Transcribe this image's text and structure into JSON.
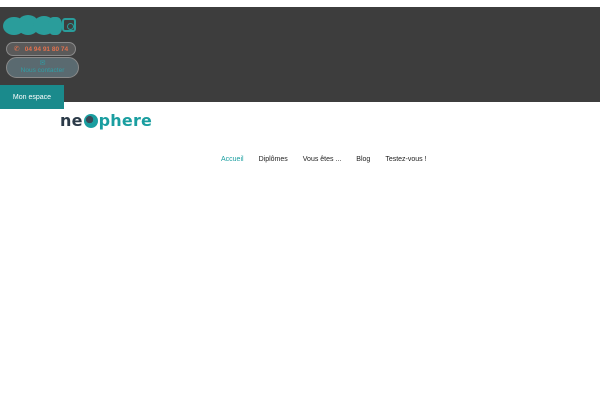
{
  "header": {
    "social_icons": [
      "facebook-icon",
      "twitter-icon",
      "youtube-icon",
      "linkedin-icon",
      "instagram-icon"
    ],
    "phone": {
      "icon": "phone-icon",
      "number": "04 94 91 80 74"
    },
    "contact": {
      "icon": "envelope-icon",
      "label": "Nous contacter"
    },
    "mon_espace": "Mon espace"
  },
  "logo": {
    "part1": "ne",
    "part2": "phere"
  },
  "nav": {
    "items": [
      "Accueil",
      "Diplômes",
      "Vous êtes ...",
      "Blog",
      "Testez-vous !"
    ],
    "active": "Accueil"
  },
  "colors": {
    "topbar": "#3d3d3d",
    "accent": "#1a9ea0",
    "phone_text": "#e0714e",
    "logo_dark": "#2b3a48"
  }
}
